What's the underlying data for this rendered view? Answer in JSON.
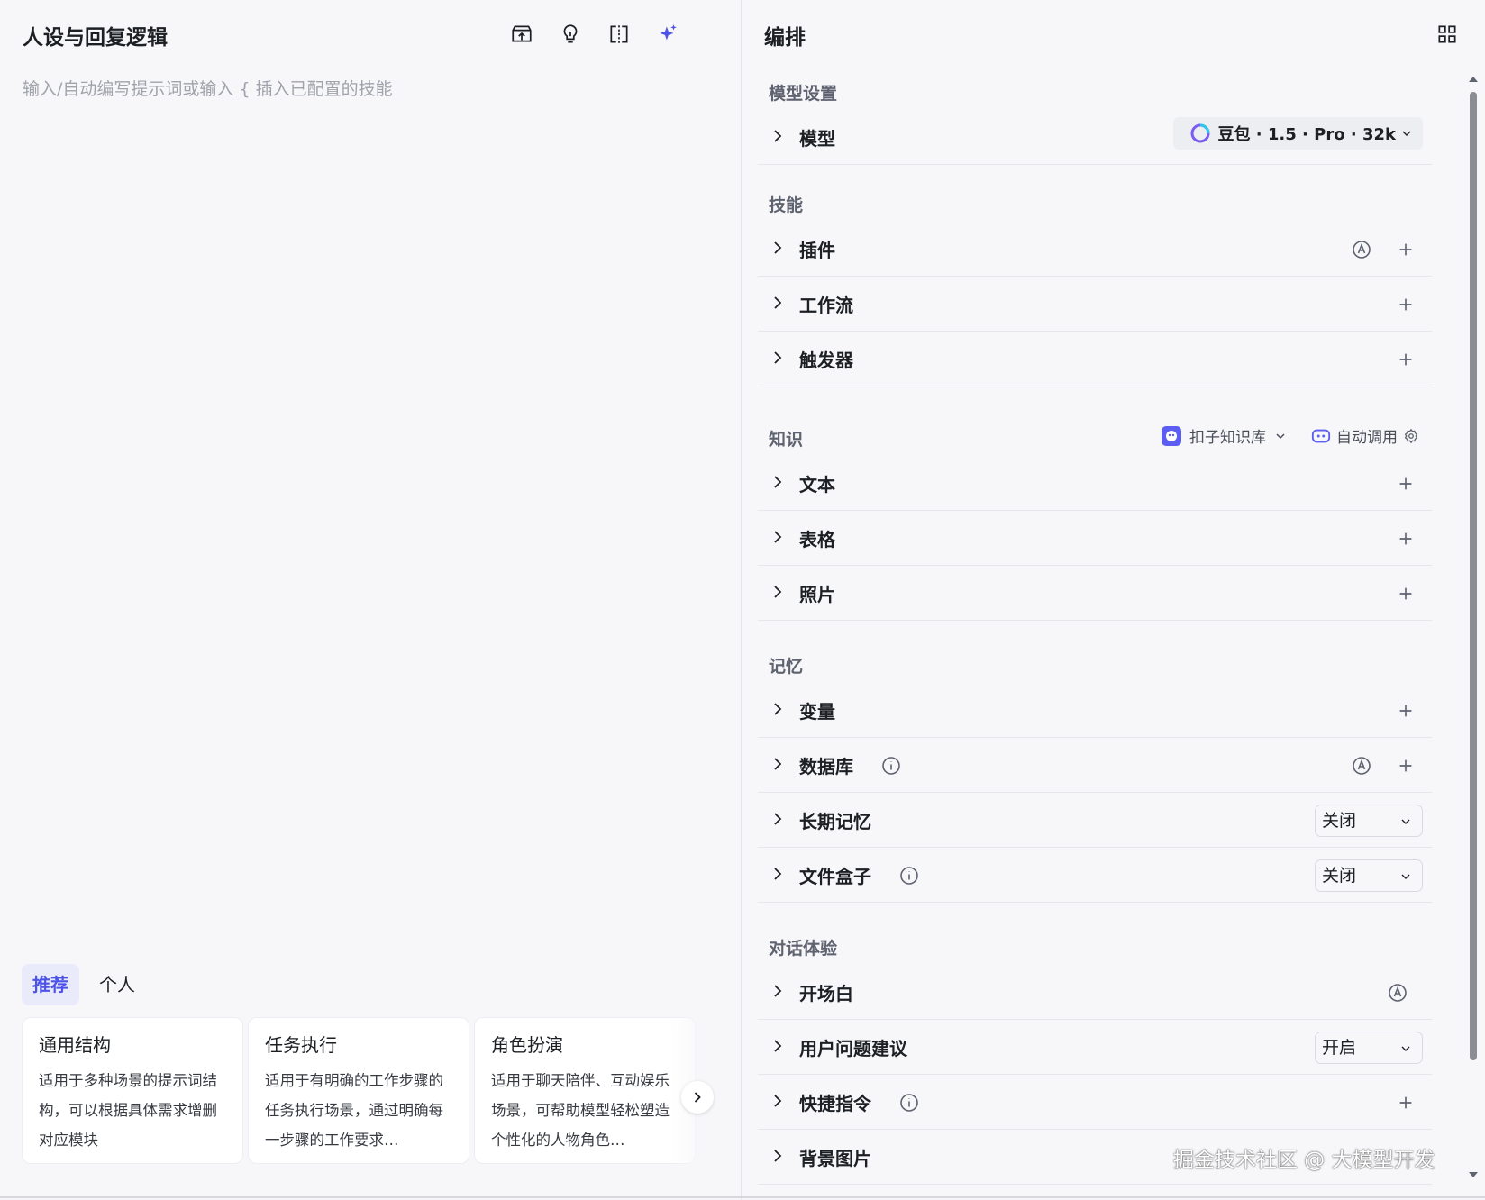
{
  "left": {
    "title": "人设与回复逻辑",
    "placeholder": "输入/自动编写提示词或输入 { 插入已配置的技能",
    "toolbar_icons": [
      "archive-upload-icon",
      "lightbulb-icon",
      "split-view-icon",
      "sparkle-icon"
    ],
    "tabs": [
      {
        "label": "推荐",
        "active": true
      },
      {
        "label": "个人",
        "active": false
      }
    ],
    "cards": [
      {
        "title": "通用结构",
        "desc": "适用于多种场景的提示词结构，可以根据具体需求增删对应模块"
      },
      {
        "title": "任务执行",
        "desc": "适用于有明确的工作步骤的任务执行场景，通过明确每一步骤的工作要求…"
      },
      {
        "title": "角色扮演",
        "desc": "适用于聊天陪伴、互动娱乐场景，可帮助模型轻松塑造个性化的人物角色…"
      }
    ]
  },
  "right": {
    "title": "编排",
    "sections": {
      "model": "模型设置",
      "skills": "技能",
      "knowledge": "知识",
      "memory": "记忆",
      "dialog": "对话体验"
    },
    "model_row": {
      "label": "模型",
      "value": "豆包 · 1.5 · Pro · 32k"
    },
    "skills_rows": [
      "插件",
      "工作流",
      "触发器"
    ],
    "knowledge_source": "扣子知识库",
    "knowledge_auto": "自动调用",
    "knowledge_rows": [
      "文本",
      "表格",
      "照片"
    ],
    "memory_rows": {
      "variables": "变量",
      "database": "数据库",
      "long_memory": "长期记忆",
      "long_memory_value": "关闭",
      "file_box": "文件盒子",
      "file_box_value": "关闭"
    },
    "dialog_rows": {
      "opening": "开场白",
      "suggestions": "用户问题建议",
      "suggestions_value": "开启",
      "shortcuts": "快捷指令",
      "background": "背景图片"
    }
  },
  "watermark": "掘金技术社区 @ 大模型开发",
  "colors": {
    "accent": "#4d53e8",
    "background": "#f7f7fa",
    "divider": "#e6e7eb"
  }
}
